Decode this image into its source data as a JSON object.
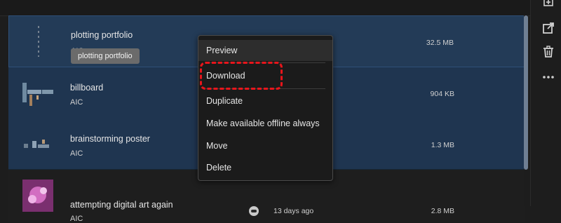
{
  "files": [
    {
      "name": "plotting portfolio",
      "type": "AIC",
      "modified": "",
      "size": "32.5 MB"
    },
    {
      "name": "billboard",
      "type": "AIC",
      "modified": "",
      "size": "904 KB"
    },
    {
      "name": "brainstorming poster",
      "type": "AIC",
      "modified": "",
      "size": "1.3 MB"
    },
    {
      "name": "attempting digital art again",
      "type": "AIC",
      "modified": "13 days ago",
      "size": "2.8 MB"
    }
  ],
  "tooltip": {
    "text": "plotting portfolio"
  },
  "context_menu": {
    "items": [
      "Preview",
      "Download",
      "Duplicate",
      "Make available offline always",
      "Move",
      "Delete"
    ],
    "hovered": "Preview",
    "highlighted": "Download"
  },
  "right_rail": {
    "icons": [
      "add-to-library-icon",
      "open-external-icon",
      "trash-icon",
      "more-icon"
    ]
  },
  "colors": {
    "selection": "#233b57",
    "annotation": "#e8151b"
  }
}
